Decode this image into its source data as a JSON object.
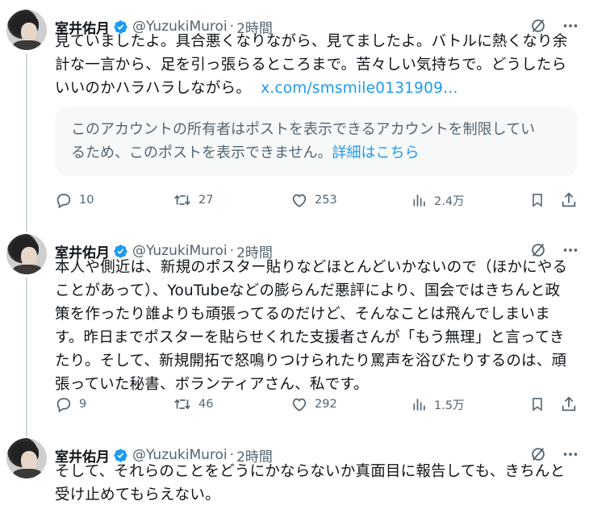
{
  "tweets": [
    {
      "author_name": "室井佑月",
      "handle": "@YuzukiMuroi",
      "separator": "·",
      "time": "2時間",
      "text_lines": [
        "見ていましたよ。具合悪くなりながら、見てましたよ。バトルに熱くなり余",
        "計な一言から、足を引っ張らるところまで。苦々しい気持ちで。どうしたら",
        "いいのかハラハラしながら。"
      ],
      "link": "x.com/smsmile0131909…",
      "notice": {
        "line1": "このアカウントの所有者はポストを表示できるアカウントを制限してい",
        "line2": "るため、このポストを表示できません。",
        "link": "詳細はこちら"
      },
      "replies": "10",
      "reposts": "27",
      "likes": "253",
      "views": "2.4万"
    },
    {
      "author_name": "室井佑月",
      "handle": "@YuzukiMuroi",
      "separator": "·",
      "time": "2時間",
      "text_lines": [
        "本人や側近は、新規のポスター貼りなどほとんどいかないので（ほかにやる",
        "ことがあって）、YouTubeなどの膨らんだ悪評により、国会ではきちんと政",
        "策を作ったり誰よりも頑張ってるのだけど、そんなことは飛んでしまいま",
        "す。昨日までポスターを貼らせくれた支援者さんが「もう無理」と言ってき",
        "たり。そして、新規開拓で怒鳴りつけられたり罵声を浴びたりするのは、頑",
        "張っていた秘書、ボランティアさん、私です。"
      ],
      "replies": "9",
      "reposts": "46",
      "likes": "292",
      "views": "1.5万"
    },
    {
      "author_name": "室井佑月",
      "handle": "@YuzukiMuroi",
      "separator": "·",
      "time": "2時間",
      "text_lines": [
        "そして、それらのことをどうにかならないか真面目に報告しても、きちんと",
        "受け止めてもらえない。"
      ]
    }
  ],
  "colors": {
    "text": "#0f1419",
    "secondary": "#536471",
    "link": "#1d9bf0",
    "verified": "#1d9bf0",
    "thread_line": "#cfd9de",
    "notice_bg": "#f7f9f9"
  },
  "icons": [
    "verified-badge-icon",
    "grok-icon",
    "more-icon",
    "reply-icon",
    "repost-icon",
    "like-icon",
    "views-icon",
    "bookmark-icon",
    "share-icon"
  ]
}
